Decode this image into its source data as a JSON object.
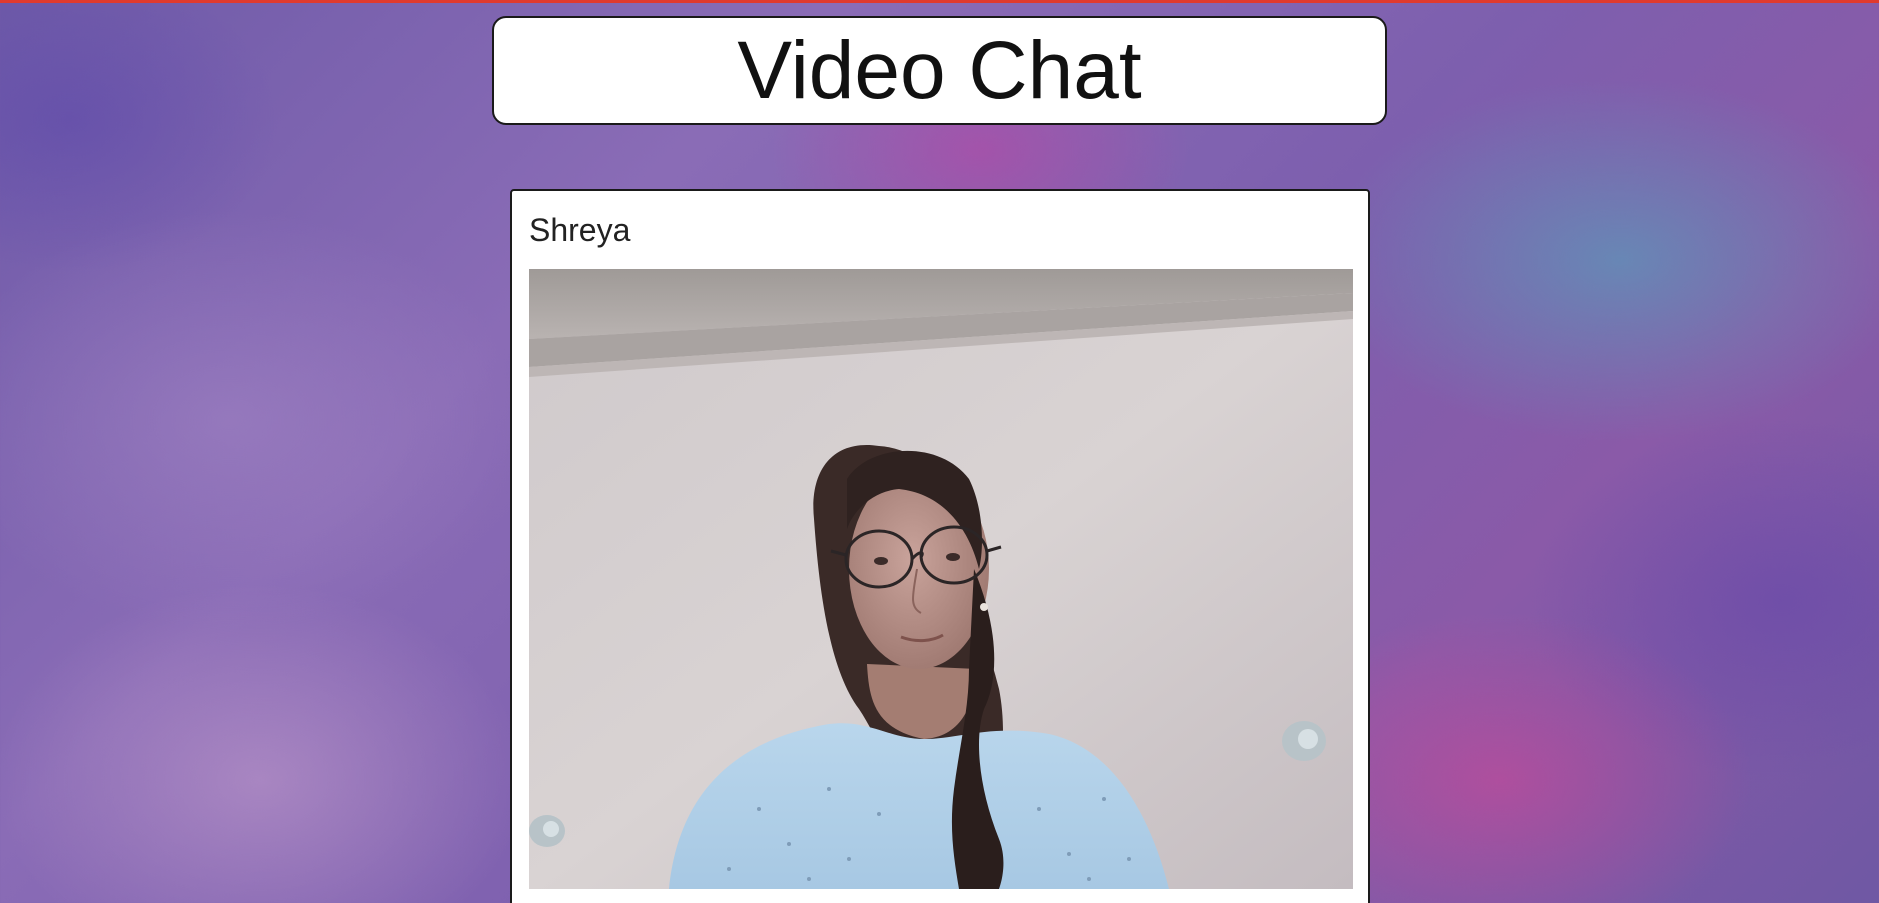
{
  "page": {
    "title": "Video Chat",
    "accent_color": "#e03a2e"
  },
  "participants": [
    {
      "name": "Shreya",
      "video_icon": "camera-feed"
    }
  ]
}
